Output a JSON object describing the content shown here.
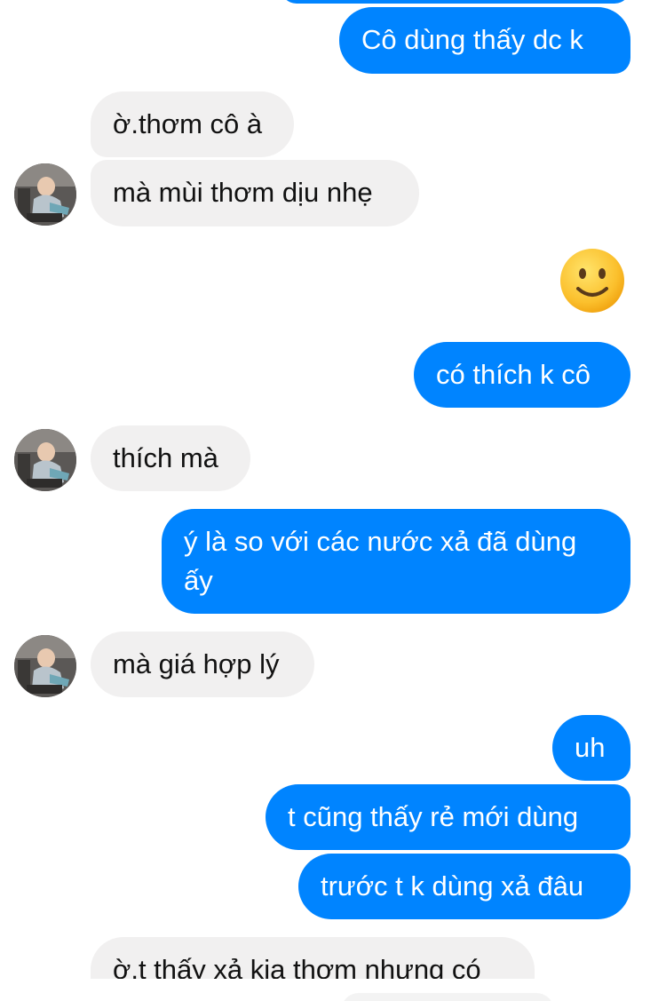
{
  "colors": {
    "outgoing_bubble": "#0084ff",
    "incoming_bubble": "#f1f0f0",
    "outgoing_text": "#ffffff",
    "incoming_text": "#111111"
  },
  "messages": [
    {
      "direction": "outgoing",
      "text": "Cô dùng thấy dc k"
    },
    {
      "direction": "incoming",
      "text": "ờ.thơm cô à"
    },
    {
      "direction": "incoming",
      "text": "mà mùi thơm dịu nhẹ"
    },
    {
      "direction": "outgoing",
      "type": "emoji",
      "icon": "slightly-smiling-face-icon"
    },
    {
      "direction": "outgoing",
      "text": "có thích k cô"
    },
    {
      "direction": "incoming",
      "text": "thích mà"
    },
    {
      "direction": "outgoing",
      "text": "ý là so với các nước xả đã dùng ấy"
    },
    {
      "direction": "incoming",
      "text": "mà giá hợp lý"
    },
    {
      "direction": "outgoing",
      "text": "uh"
    },
    {
      "direction": "outgoing",
      "text": "t cũng thấy rẻ mới dùng"
    },
    {
      "direction": "outgoing",
      "text": "trước t k dùng xả đâu"
    },
    {
      "direction": "incoming",
      "text": "ờ.t thấy xả kia thơm nhưng có"
    }
  ],
  "avatar": {
    "icon": "contact-avatar"
  }
}
